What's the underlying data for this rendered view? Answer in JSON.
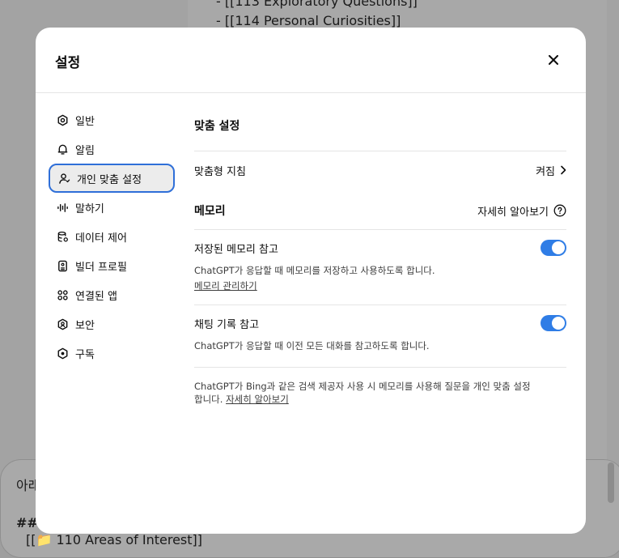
{
  "background": {
    "lines": [
      "- [[113 Exploratory Questions]]",
      "- [[114 Personal Curiosities]]"
    ],
    "composer_text": "아래",
    "heading_fragment": "##",
    "bottom_line": "[[📁 110 Areas of Interest]]"
  },
  "modal": {
    "title": "설정",
    "close_icon": "close-icon"
  },
  "sidebar": {
    "items": [
      {
        "label": "일반",
        "icon": "gear-icon"
      },
      {
        "label": "알림",
        "icon": "bell-icon"
      },
      {
        "label": "개인 맞춤 설정",
        "icon": "user-icon",
        "active": true
      },
      {
        "label": "말하기",
        "icon": "waveform-icon"
      },
      {
        "label": "데이터 제어",
        "icon": "database-icon"
      },
      {
        "label": "빌더 프로필",
        "icon": "id-card-icon"
      },
      {
        "label": "연결된 앱",
        "icon": "apps-icon"
      },
      {
        "label": "보안",
        "icon": "shield-icon"
      },
      {
        "label": "구독",
        "icon": "subscription-icon"
      }
    ]
  },
  "content": {
    "personalization_title": "맞춤 설정",
    "custom_instructions_label": "맞춤형 지침",
    "custom_instructions_value": "켜짐",
    "memory_title": "메모리",
    "learn_more": "자세히 알아보기",
    "saved_memory_label": "저장된 메모리 참고",
    "saved_memory_desc": "ChatGPT가 응답할 때 메모리를 저장하고 사용하도록 합니다.",
    "manage_memory_link": "메모리 관리하기",
    "saved_memory_on": true,
    "chat_history_label": "채팅 기록 참고",
    "chat_history_desc": "ChatGPT가 응답할 때 이전 모든 대화를 참고하도록 합니다.",
    "chat_history_on": true,
    "bing_note_line1": "ChatGPT가 Bing과 같은 검색 제공자 사용 시 메모리를 사용해 질문을 개인 맞춤 설정",
    "bing_note_line2": "합니다.",
    "bing_note_link": "자세히 알아보기"
  },
  "colors": {
    "accent": "#2f7de6",
    "active_border": "#2f6fd8"
  }
}
